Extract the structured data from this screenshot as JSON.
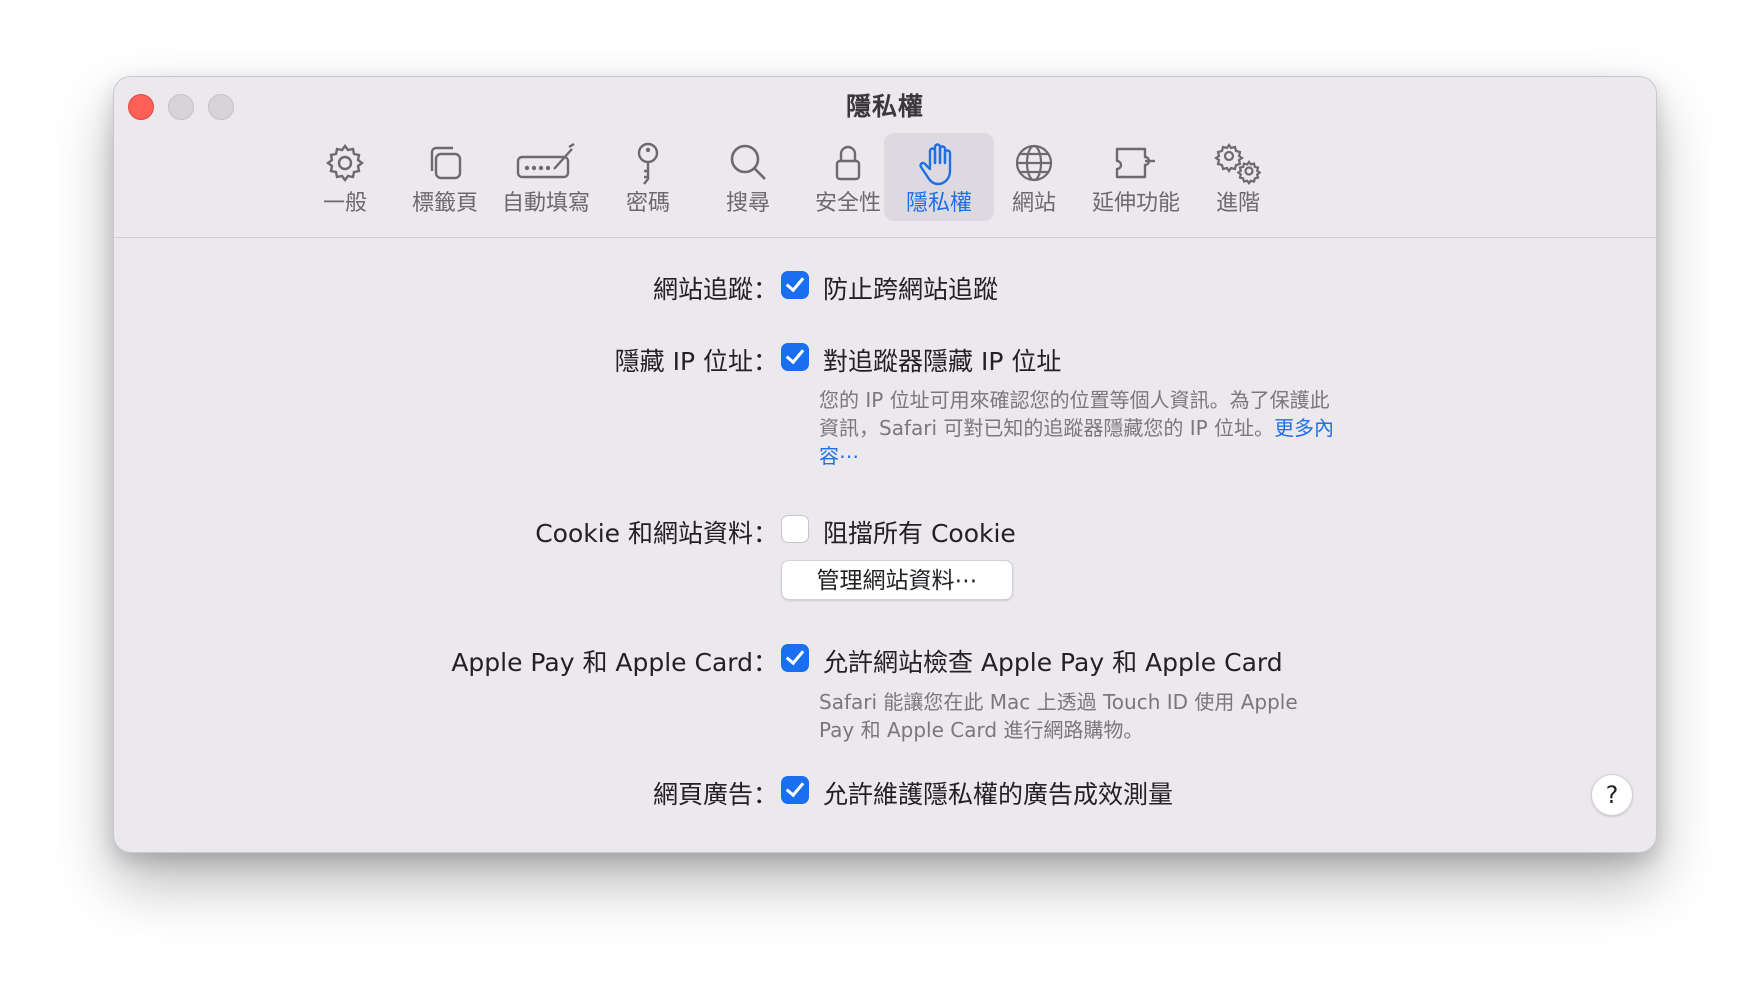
{
  "window": {
    "title": "隱私權"
  },
  "tabs": [
    {
      "label": "一般",
      "icon": "gear-icon"
    },
    {
      "label": "標籤頁",
      "icon": "tabs-icon"
    },
    {
      "label": "自動填寫",
      "icon": "autofill-icon"
    },
    {
      "label": "密碼",
      "icon": "key-icon"
    },
    {
      "label": "搜尋",
      "icon": "search-icon"
    },
    {
      "label": "安全性",
      "icon": "lock-icon"
    },
    {
      "label": "隱私權",
      "icon": "hand-icon",
      "active": true
    },
    {
      "label": "網站",
      "icon": "globe-icon"
    },
    {
      "label": "延伸功能",
      "icon": "extension-icon"
    },
    {
      "label": "進階",
      "icon": "gears-icon"
    }
  ],
  "settings": {
    "tracking": {
      "label": "網站追蹤：",
      "checkbox_label": "防止跨網站追蹤",
      "checked": true
    },
    "hide_ip": {
      "label": "隱藏 IP 位址：",
      "checkbox_label": "對追蹤器隱藏 IP 位址",
      "checked": true,
      "description": "您的 IP 位址可用來確認您的位置等個人資訊。為了保護此資訊，Safari 可對已知的追蹤器隱藏您的 IP 位址。",
      "link": "更多內容⋯"
    },
    "cookies": {
      "label": "Cookie 和網站資料：",
      "checkbox_label": "阻擋所有 Cookie",
      "checked": false,
      "button": "管理網站資料⋯"
    },
    "apple_pay": {
      "label": "Apple Pay 和 Apple Card：",
      "checkbox_label": "允許網站檢查 Apple Pay 和 Apple Card",
      "checked": true,
      "description": "Safari 能讓您在此 Mac 上透過 Touch ID 使用 Apple Pay 和 Apple Card 進行網路購物。"
    },
    "ads": {
      "label": "網頁廣告：",
      "checkbox_label": "允許維護隱私權的廣告成效測量",
      "checked": true
    }
  },
  "help": "?",
  "colors": {
    "accent": "#1f6fe5",
    "checkbox": "#1a6ff0",
    "close": "#fe5f57"
  }
}
